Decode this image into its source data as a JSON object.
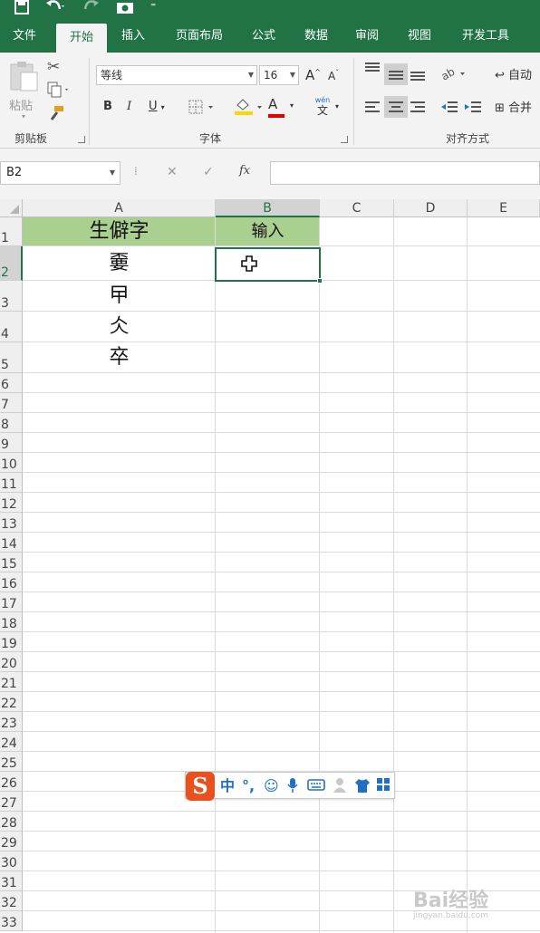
{
  "ribbon": {
    "tabs": [
      "文件",
      "开始",
      "插入",
      "页面布局",
      "公式",
      "数据",
      "审阅",
      "视图",
      "开发工具"
    ],
    "active_tab": "开始",
    "clipboard": {
      "paste_label": "粘贴",
      "group_label": "剪贴板"
    },
    "font": {
      "font_name": "等线",
      "font_size": "16",
      "bold": "B",
      "italic": "I",
      "underline": "U",
      "grow": "A",
      "shrink": "A",
      "phonetic_top": "wén",
      "phonetic_bottom": "文",
      "font_color_glyph": "A",
      "group_label": "字体"
    },
    "alignment": {
      "wrap_label": "自动",
      "merge_label": "合并",
      "group_label": "对齐方式"
    },
    "colors": {
      "accent": "#217346",
      "header_fill": "#a9d08e",
      "font_red": "#e00000",
      "fill_yellow": "#ffd400"
    }
  },
  "formula_bar": {
    "name_box": "B2",
    "fx_label": "fx",
    "formula": ""
  },
  "sheet": {
    "columns": [
      "A",
      "B",
      "C",
      "D",
      "E"
    ],
    "selected_column": "B",
    "selected_row": "2",
    "rows": [
      "1",
      "2",
      "3",
      "4",
      "5",
      "6",
      "7",
      "8",
      "9",
      "10",
      "11",
      "12",
      "13",
      "14",
      "15",
      "16",
      "17",
      "18",
      "19",
      "20",
      "21",
      "22",
      "23",
      "24",
      "25",
      "26",
      "27",
      "28",
      "29",
      "30",
      "31",
      "32",
      "33"
    ],
    "cells": {
      "A1": "生僻字",
      "B1": "输入",
      "A2": "嫑",
      "A3": "曱",
      "A4": "仌",
      "A5": "卒"
    }
  },
  "ime": {
    "logo": "S",
    "mode": "中",
    "punct": "°,",
    "icons": [
      "smiley-icon",
      "microphone-icon",
      "keyboard-icon",
      "user-icon",
      "tshirt-icon",
      "grid-icon"
    ]
  },
  "watermark": {
    "brand": "Bai经验",
    "site": "jingyan.baidu.com"
  }
}
